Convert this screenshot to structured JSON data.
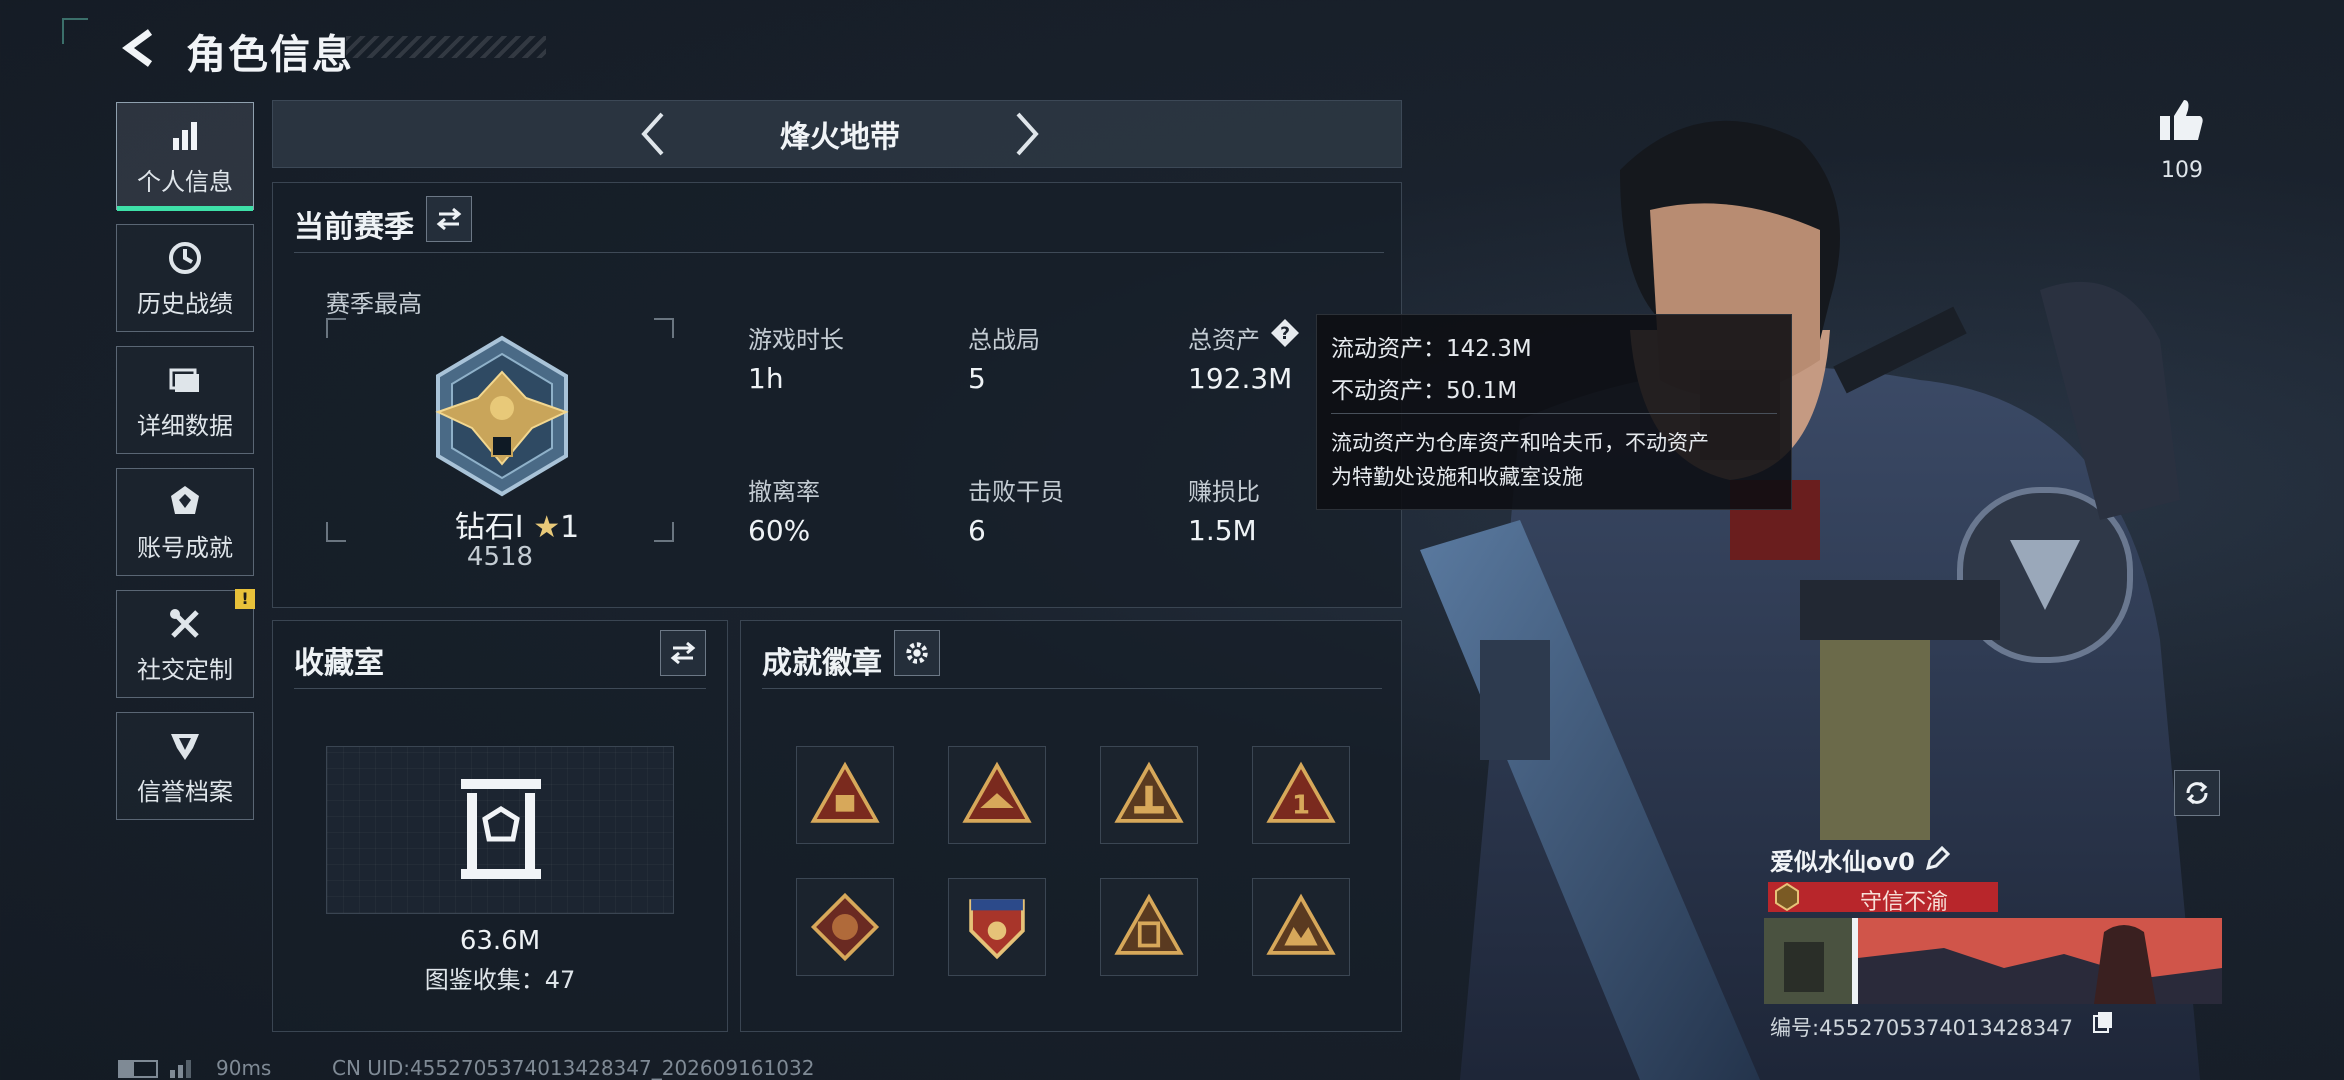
{
  "header": {
    "title": "角色信息",
    "back_icon": "back-arrow-icon"
  },
  "sidebar": {
    "items": [
      {
        "label": "个人信息",
        "icon": "bar-chart-icon",
        "active": true
      },
      {
        "label": "历史战绩",
        "icon": "history-clock-icon"
      },
      {
        "label": "详细数据",
        "icon": "folder-icon"
      },
      {
        "label": "账号成就",
        "icon": "achievement-badge-icon"
      },
      {
        "label": "社交定制",
        "icon": "wrench-tools-icon",
        "alert": "!"
      },
      {
        "label": "信誉档案",
        "icon": "credit-emblem-icon"
      }
    ]
  },
  "mode": {
    "title": "烽火地带"
  },
  "season": {
    "title": "当前赛季",
    "best_label": "赛季最高",
    "rank_name": "钻石Ⅰ",
    "rank_stars": "1",
    "rank_points": "4518",
    "stats": [
      {
        "label": "游戏时长",
        "value": "1h"
      },
      {
        "label": "总战局",
        "value": "5"
      },
      {
        "label": "总资产",
        "value": "192.3M"
      },
      {
        "label": "撤离率",
        "value": "60%"
      },
      {
        "label": "击败干员",
        "value": "6"
      },
      {
        "label": "赚损比",
        "value": "1.5M"
      }
    ]
  },
  "tooltip": {
    "liquid": "流动资产：142.3M",
    "fixed": "不动资产：50.1M",
    "desc_line1": "流动资产为仓库资产和哈夫币，不动资产",
    "desc_line2": "为特勤处设施和收藏室设施"
  },
  "collection": {
    "title": "收藏室",
    "value": "63.6M",
    "count_label": "图鉴收集：47"
  },
  "achievements": {
    "title": "成就徽章",
    "badges": [
      "badge-1",
      "badge-2",
      "badge-3",
      "badge-4",
      "badge-5",
      "badge-6",
      "badge-7",
      "badge-8"
    ]
  },
  "player": {
    "likes": "109",
    "name": "爱似水仙ov0",
    "title": "守信不渝",
    "id_label": "编号:4552705374013428347"
  },
  "status": {
    "ping": "90ms",
    "uid": "CN UID:4552705374013428347_202609161032"
  },
  "colors": {
    "accent": "#3ee0a8",
    "title_red": "#b8262b",
    "alert": "#e8c13a"
  }
}
